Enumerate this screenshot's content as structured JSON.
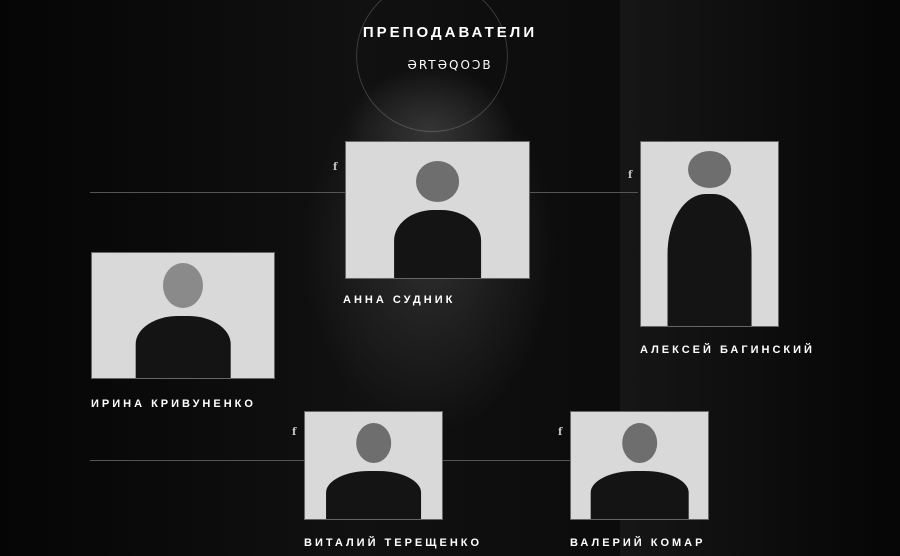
{
  "header": {
    "title": "ПРЕПОДАВАТЕЛИ",
    "brand": "ƏRTƏQOƆB"
  },
  "teachers": [
    {
      "name": "АННА СУДНИК"
    },
    {
      "name": "АЛЕКСЕЙ БАГИНСКИЙ"
    },
    {
      "name": "ИРИНА КРИВУНЕНКО"
    },
    {
      "name": "ВИТАЛИЙ ТЕРЕЩЕНКО"
    },
    {
      "name": "ВАЛЕРИЙ КОМАР"
    }
  ],
  "social": {
    "facebook": "f",
    "instagram": "instagram-icon"
  }
}
